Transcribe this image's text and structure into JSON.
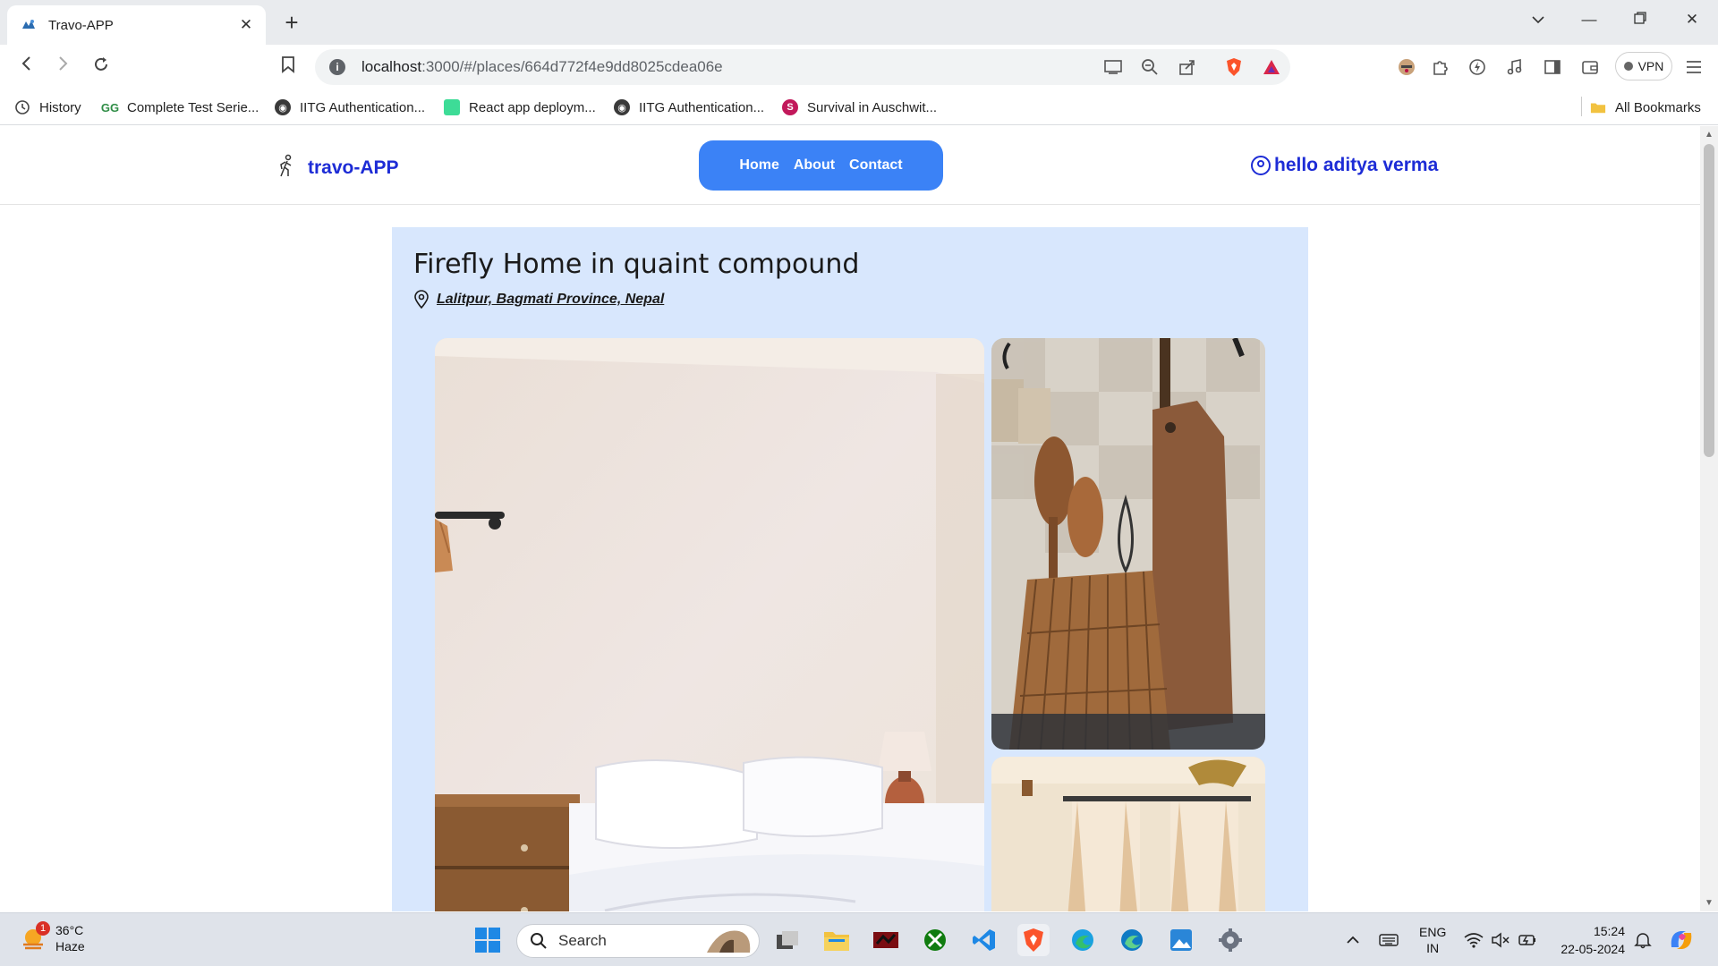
{
  "browser": {
    "tab_title": "Travo-APP",
    "url_host": "localhost",
    "url_rest": ":3000/#/places/664d772f4e9dd8025cdea06e",
    "vpn_label": "VPN",
    "bookmarks": [
      {
        "label": "History",
        "icon": "history-icon"
      },
      {
        "label": "Complete Test Serie...",
        "icon": "gfg-icon"
      },
      {
        "label": "IITG Authentication...",
        "icon": "globe-icon"
      },
      {
        "label": "React app deploym...",
        "icon": "page-icon"
      },
      {
        "label": "IITG Authentication...",
        "icon": "globe-icon"
      },
      {
        "label": "Survival in Auschwit...",
        "icon": "s-icon"
      }
    ],
    "all_bookmarks": "All Bookmarks"
  },
  "site": {
    "brand": "travo-APP",
    "nav": [
      "Home",
      "About",
      "Contact"
    ],
    "user_greeting": "hello aditya verma"
  },
  "place": {
    "title": "Firefly Home in quaint compound",
    "location": "Lalitpur, Bagmati Province, Nepal"
  },
  "taskbar": {
    "temperature": "36°C",
    "weather": "Haze",
    "weather_badge": "1",
    "search_placeholder": "Search",
    "lang_top": "ENG",
    "lang_bottom": "IN",
    "time": "15:24",
    "date": "22-05-2024"
  }
}
